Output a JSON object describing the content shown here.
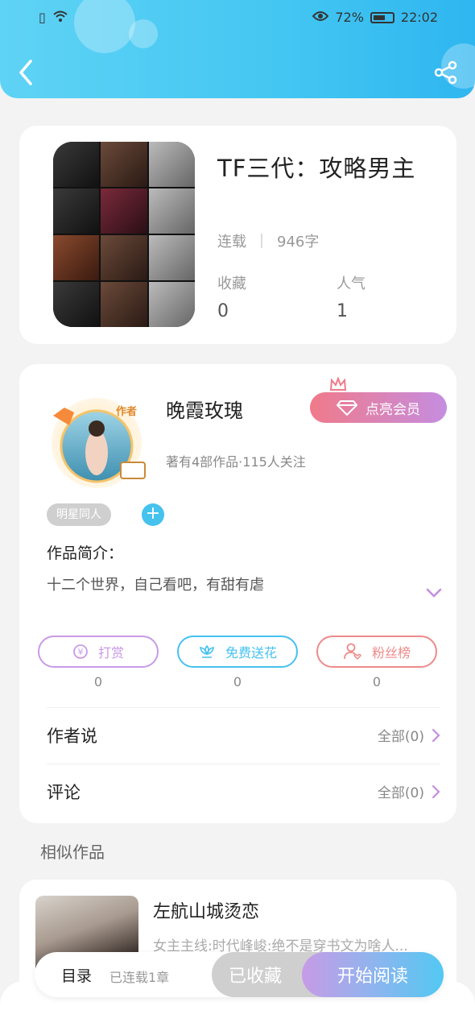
{
  "status_bar": {
    "battery": "72%",
    "time": "22:02"
  },
  "book": {
    "title": "TF三代：攻略男主",
    "status": "连载",
    "word_count": "946字",
    "favorites_label": "收藏",
    "favorites_value": "0",
    "popularity_label": "人气",
    "popularity_value": "1"
  },
  "author": {
    "name": "晚霞玫瑰",
    "avatar_badge": "作者",
    "summary": "著有4部作品·115人关注",
    "vip_label": "点亮会员",
    "tag": "明星同人",
    "tag_add": "+",
    "intro_title": "作品简介：",
    "intro_text": "十二个世界，自己看吧，有甜有虐"
  },
  "actions": [
    {
      "label": "打赏",
      "count": "0",
      "color": "#c99ae6",
      "icon": "coin-icon"
    },
    {
      "label": "免费送花",
      "count": "0",
      "color": "#45c2ee",
      "icon": "flower-icon"
    },
    {
      "label": "粉丝榜",
      "count": "0",
      "color": "#ee8a8a",
      "icon": "fan-ranking-icon"
    }
  ],
  "sections": {
    "author_says": {
      "label": "作者说",
      "more": "全部(0)"
    },
    "comments": {
      "label": "评论",
      "more": "全部(0)"
    }
  },
  "similar": {
    "title": "相似作品",
    "items": [
      {
        "name": "左航山城烫恋",
        "desc": "女主主线:时代峰峻:绝不是穿书文为啥人..."
      }
    ]
  },
  "bottom_bar": {
    "toc": "目录",
    "chapters": "已连载1章",
    "favorited": "已收藏",
    "start_reading": "开始阅读"
  },
  "colors": {
    "header": "#43c6f2",
    "accent_purple": "#c58de0",
    "accent_blue": "#45c2ee",
    "accent_red": "#ee8a8a"
  }
}
